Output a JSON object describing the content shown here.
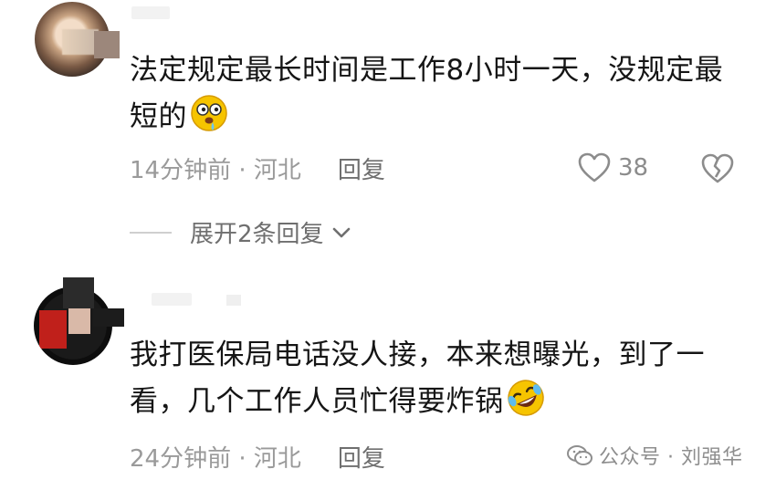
{
  "comments": [
    {
      "text": "法定规定最长时间是工作8小时一天，没规定最短的",
      "emoji": "drooling-face-icon",
      "time_location": "14分钟前 · 河北",
      "reply_label": "回复",
      "like_count": "38",
      "expand_label": "展开2条回复"
    },
    {
      "text": "我打医保局电话没人接，本来想曝光，到了一看，几个工作人员忙得要炸锅",
      "emoji": "rolling-on-floor-laughing-icon",
      "time_location": "24分钟前 · 河北",
      "reply_label": "回复"
    }
  ],
  "watermark": {
    "text": "公众号 · 刘强华",
    "icon": "wechat-icon"
  },
  "colors": {
    "text_primary": "#151515",
    "text_meta": "#9a9a9a",
    "text_secondary": "#6f6f6f",
    "icon": "#8c8c8c",
    "emoji_yellow": "#f6c400"
  }
}
